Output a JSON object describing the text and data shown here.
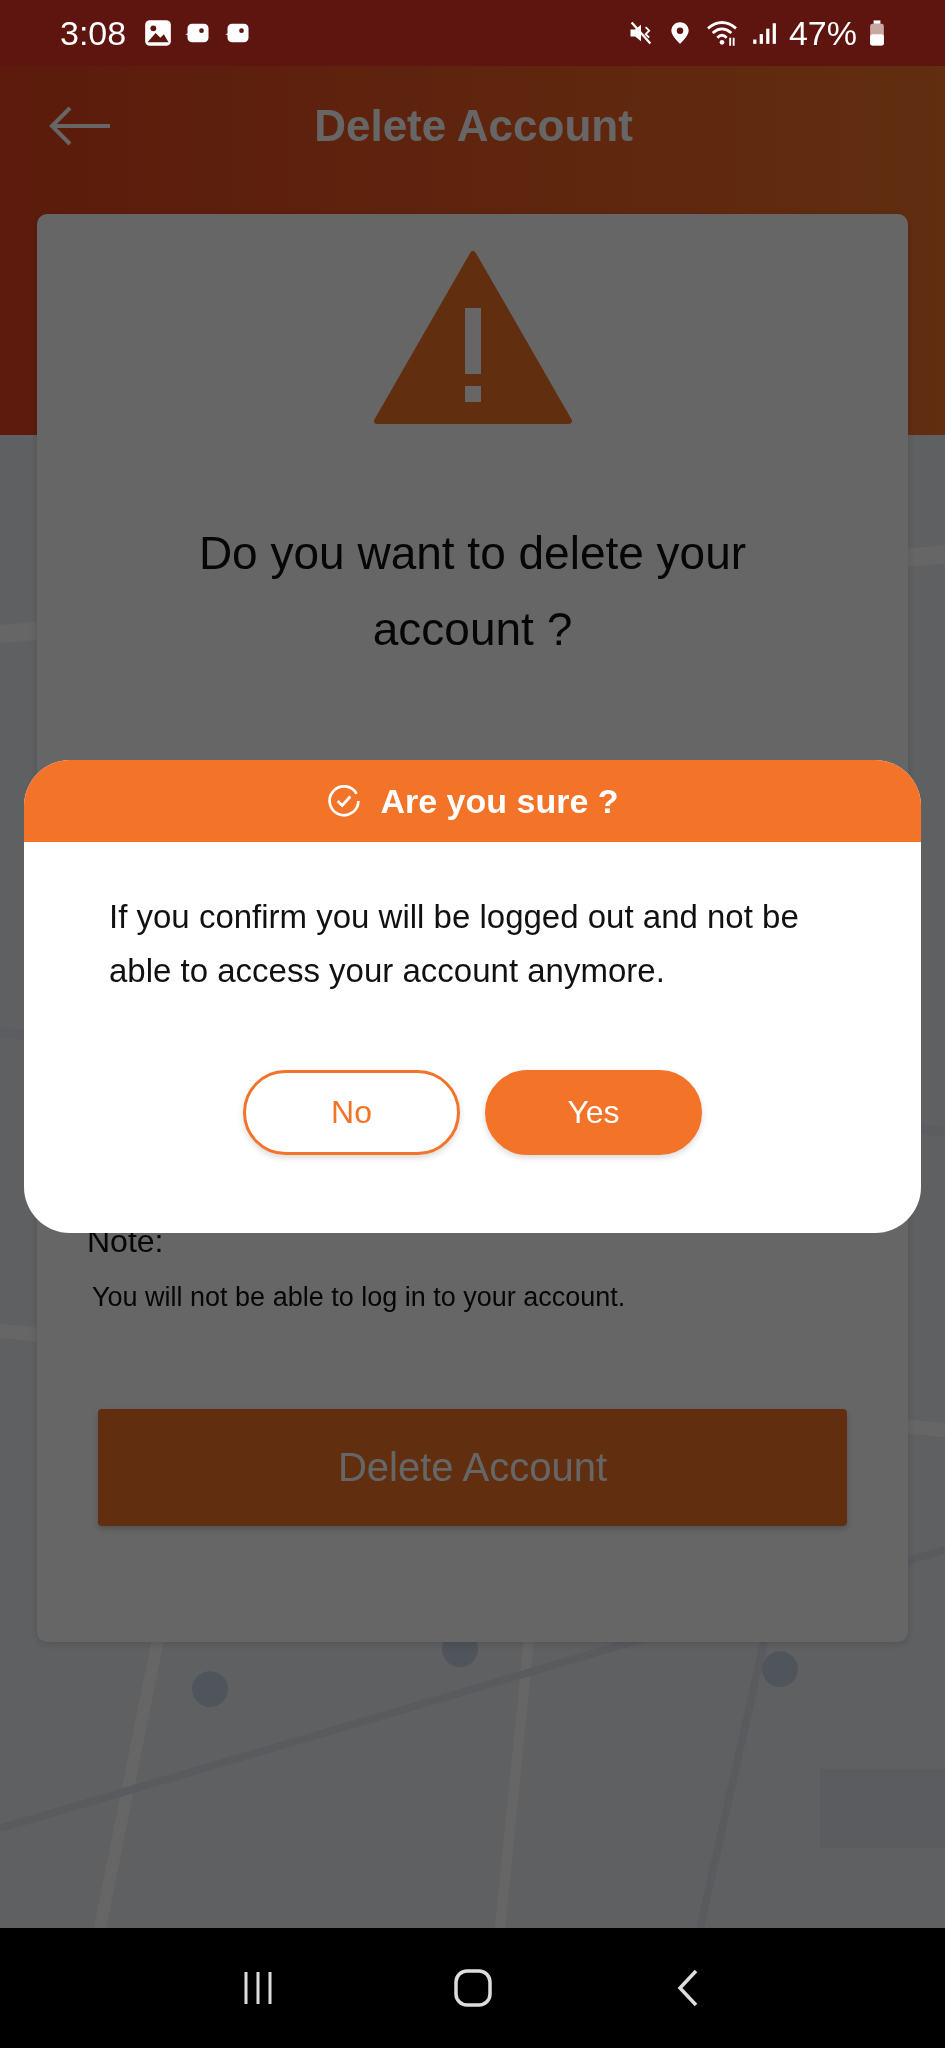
{
  "status_bar": {
    "time": "3:08",
    "battery": "47%"
  },
  "header": {
    "title": "Delete Account"
  },
  "card": {
    "question": "Do you want to delete your account ?",
    "note_label": "Note:",
    "note": "You will not be able to log in to your account.",
    "button": "Delete Account"
  },
  "dialog": {
    "title": "Are you sure ?",
    "message": "If you confirm you will be logged out and not be able to access your account anymore.",
    "buttons": [
      {
        "label": "No",
        "kind": "outline"
      },
      {
        "label": "Yes",
        "kind": "filled"
      }
    ]
  }
}
